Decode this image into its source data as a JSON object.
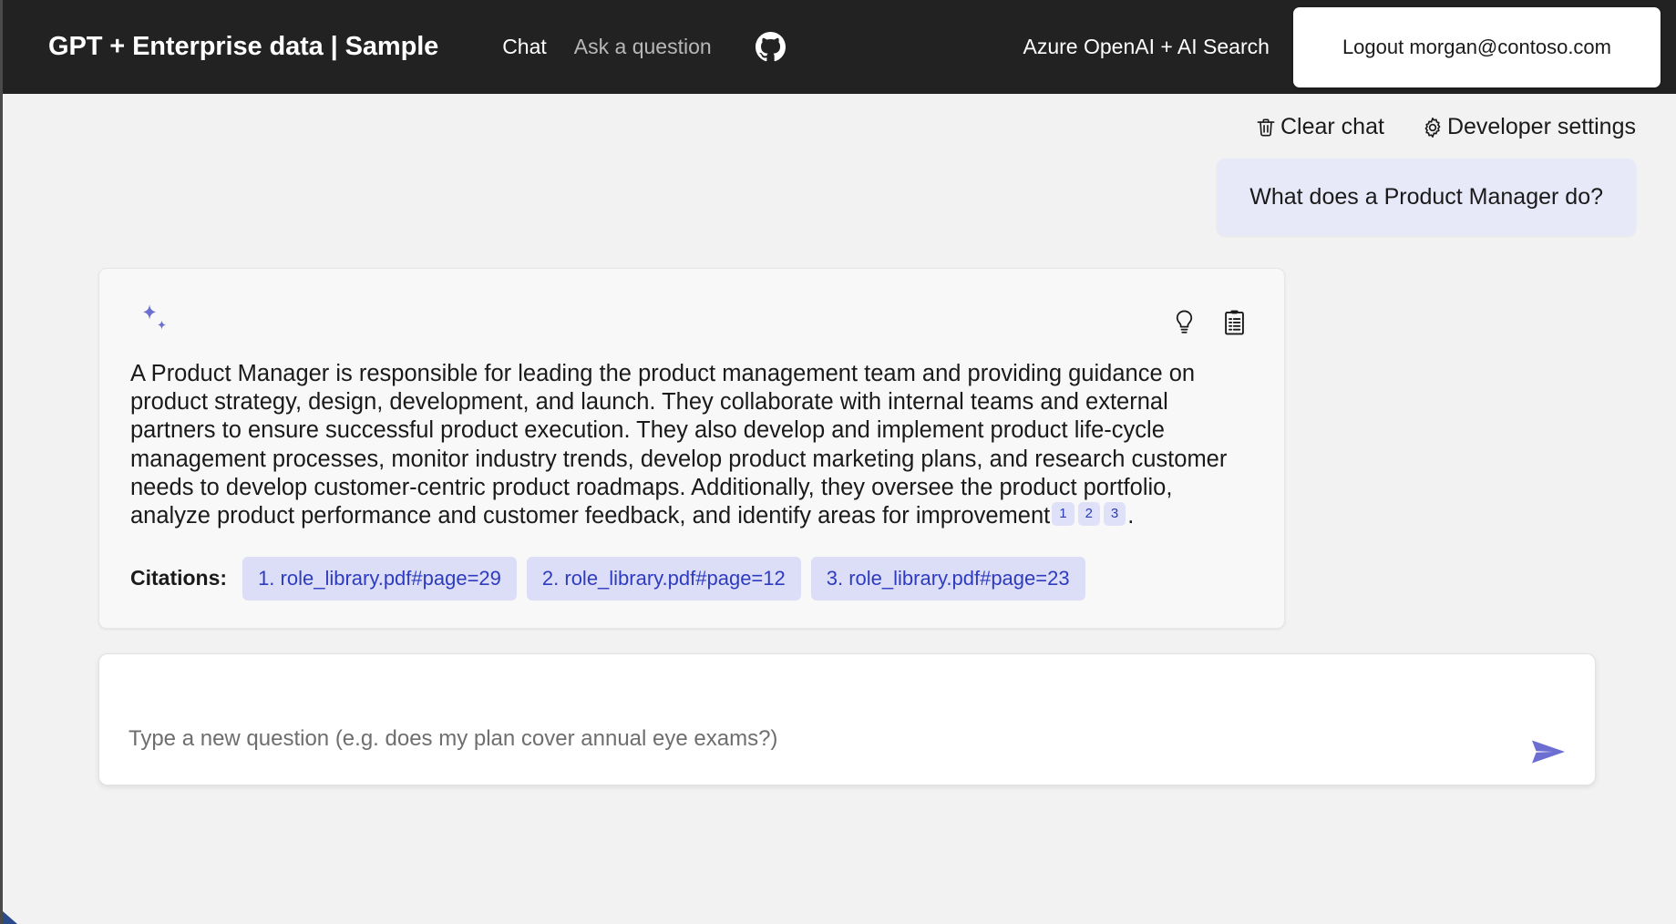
{
  "header": {
    "title": "GPT + Enterprise data | Sample",
    "nav": [
      {
        "label": "Chat",
        "active": true
      },
      {
        "label": "Ask a question",
        "active": false
      }
    ],
    "github_icon": "github-icon",
    "subtitle": "Azure OpenAI + AI Search",
    "logout_label": "Logout morgan@contoso.com"
  },
  "command_bar": {
    "clear_chat": {
      "label": "Clear chat",
      "icon": "trash-icon"
    },
    "developer_settings": {
      "label": "Developer settings",
      "icon": "gear-icon"
    }
  },
  "chat": {
    "user_message": "What does a Product Manager do?",
    "answer": {
      "avatar_icon": "sparkle-icon",
      "actions": [
        {
          "name": "thought-process-button",
          "icon": "lightbulb-icon"
        },
        {
          "name": "supporting-content-button",
          "icon": "clipboard-icon"
        }
      ],
      "body_part_1": "A Product Manager is responsible for leading the product management team and providing guidance on product strategy, design, development, and launch. They collaborate with internal teams and external partners to ensure successful product execution. They also develop and implement product life-cycle management processes, monitor industry trends, develop product marketing plans, and research customer needs to develop customer-centric product roadmaps. Additionally, they oversee the product portfolio, analyze product performance and customer feedback, and identify areas for improvement",
      "inline_citations": [
        "1",
        "2",
        "3"
      ],
      "body_part_2": ".",
      "citations_label": "Citations:",
      "citations": [
        "1. role_library.pdf#page=29",
        "2. role_library.pdf#page=12",
        "3. role_library.pdf#page=23"
      ]
    }
  },
  "input": {
    "placeholder": "Type a new question (e.g. does my plan cover annual eye exams?)",
    "value": "",
    "send_icon": "send-icon"
  },
  "colors": {
    "header_bg": "#222222",
    "page_bg": "#f2f2f2",
    "accent_purple": "#6c6fd1",
    "citation_bg": "#dcdef8",
    "citation_text": "#2e3bbf",
    "user_bubble_bg": "#e8e9f8"
  }
}
